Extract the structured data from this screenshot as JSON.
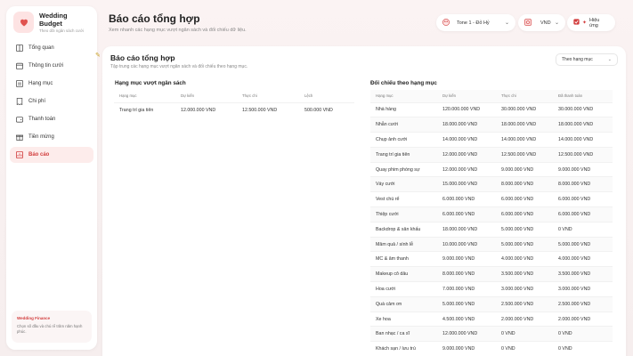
{
  "app": {
    "title": "Wedding Budget",
    "subtitle": "Theo dõi ngân sách cưới"
  },
  "sidebar": {
    "items": [
      {
        "label": "Tổng quan",
        "icon": "grid-icon"
      },
      {
        "label": "Thông tin cưới",
        "icon": "calendar-icon"
      },
      {
        "label": "Hạng mục",
        "icon": "list-icon"
      },
      {
        "label": "Chi phí",
        "icon": "receipt-icon"
      },
      {
        "label": "Thanh toán",
        "icon": "wallet-icon"
      },
      {
        "label": "Tiền mừng",
        "icon": "gift-icon"
      },
      {
        "label": "Báo cáo",
        "icon": "report-icon",
        "active": true
      }
    ],
    "footer": {
      "title": "Wedding Finance",
      "desc": "Chọn số đầu và chú rể trăm năm hạnh phúc."
    }
  },
  "header": {
    "title": "Báo cáo tổng hợp",
    "subtitle": "Xem nhanh các hạng mục vượt ngân sách và đối chiếu dữ liệu.",
    "theme": "Tone 1 - Đỏ Hỷ",
    "currency": "VND",
    "effects": "Hiệu ứng"
  },
  "panel": {
    "title": "Báo cáo tổng hợp",
    "subtitle": "Tập trung các hạng mục vượt ngân sách và đối chiếu theo hạng mục.",
    "filter": "Theo hạng mục"
  },
  "over_budget": {
    "title": "Hạng mục vượt ngân sách",
    "columns": [
      "Hạng mục",
      "Dự kiến",
      "Thực chi",
      "Lệch"
    ],
    "rows": [
      [
        "Trang trí gia tiên",
        "12.000.000 VND",
        "12.500.000 VND",
        "500.000 VND"
      ]
    ]
  },
  "compare": {
    "title": "Đối chiếu theo hạng mục",
    "columns": [
      "Hạng mục",
      "Dự kiến",
      "Thực chi",
      "Đã thanh toán"
    ],
    "rows": [
      [
        "Nhà hàng",
        "120.000.000 VND",
        "30.000.000 VND",
        "30.000.000 VND"
      ],
      [
        "Nhẫn cưới",
        "18.000.000 VND",
        "18.000.000 VND",
        "18.000.000 VND"
      ],
      [
        "Chụp ảnh cưới",
        "14.000.000 VND",
        "14.000.000 VND",
        "14.000.000 VND"
      ],
      [
        "Trang trí gia tiên",
        "12.000.000 VND",
        "12.500.000 VND",
        "12.500.000 VND"
      ],
      [
        "Quay phim phóng sự",
        "12.000.000 VND",
        "9.000.000 VND",
        "9.000.000 VND"
      ],
      [
        "Váy cưới",
        "15.000.000 VND",
        "8.000.000 VND",
        "8.000.000 VND"
      ],
      [
        "Vest chú rể",
        "6.000.000 VND",
        "6.000.000 VND",
        "6.000.000 VND"
      ],
      [
        "Thiệp cưới",
        "6.000.000 VND",
        "6.000.000 VND",
        "6.000.000 VND"
      ],
      [
        "Backdrop & sân khấu",
        "18.000.000 VND",
        "5.000.000 VND",
        "0 VND"
      ],
      [
        "Mâm quả / sính lễ",
        "10.000.000 VND",
        "5.000.000 VND",
        "5.000.000 VND"
      ],
      [
        "MC & âm thanh",
        "9.000.000 VND",
        "4.000.000 VND",
        "4.000.000 VND"
      ],
      [
        "Makeup cô dâu",
        "8.000.000 VND",
        "3.500.000 VND",
        "3.500.000 VND"
      ],
      [
        "Hoa cưới",
        "7.000.000 VND",
        "3.000.000 VND",
        "3.000.000 VND"
      ],
      [
        "Quà cảm ơn",
        "5.000.000 VND",
        "2.500.000 VND",
        "2.500.000 VND"
      ],
      [
        "Xe hoa",
        "4.500.000 VND",
        "2.000.000 VND",
        "2.000.000 VND"
      ],
      [
        "Ban nhạc / ca sĩ",
        "12.000.000 VND",
        "0 VND",
        "0 VND"
      ],
      [
        "Khách sạn / lưu trú",
        "9.000.000 VND",
        "0 VND",
        "0 VND"
      ]
    ]
  },
  "colors": {
    "accent": "#d23d3d",
    "accent_soft": "#fdeceb"
  }
}
